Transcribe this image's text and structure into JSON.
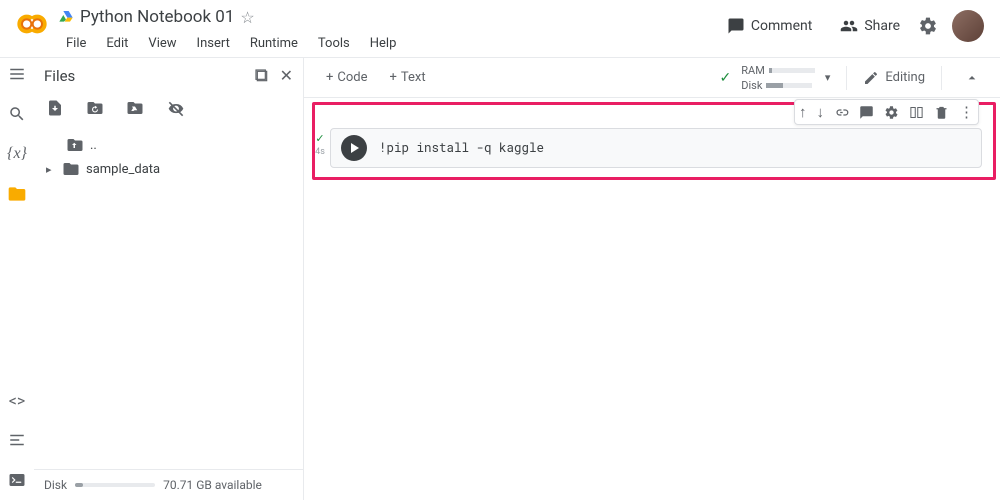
{
  "header": {
    "title": "Python Notebook 01",
    "menu": [
      "File",
      "Edit",
      "View",
      "Insert",
      "Runtime",
      "Tools",
      "Help"
    ],
    "comment": "Comment",
    "share": "Share"
  },
  "sidebar": {
    "title": "Files",
    "items": [
      {
        "name": "..",
        "icon": "up"
      },
      {
        "name": "sample_data",
        "icon": "folder"
      }
    ],
    "disk_label": "Disk",
    "disk_avail": "70.71 GB available"
  },
  "main": {
    "add_code": "Code",
    "add_text": "Text",
    "ram_label": "RAM",
    "disk_label": "Disk",
    "editing": "Editing"
  },
  "cell": {
    "exec_time": "4s",
    "code": "!pip install -q kaggle"
  }
}
